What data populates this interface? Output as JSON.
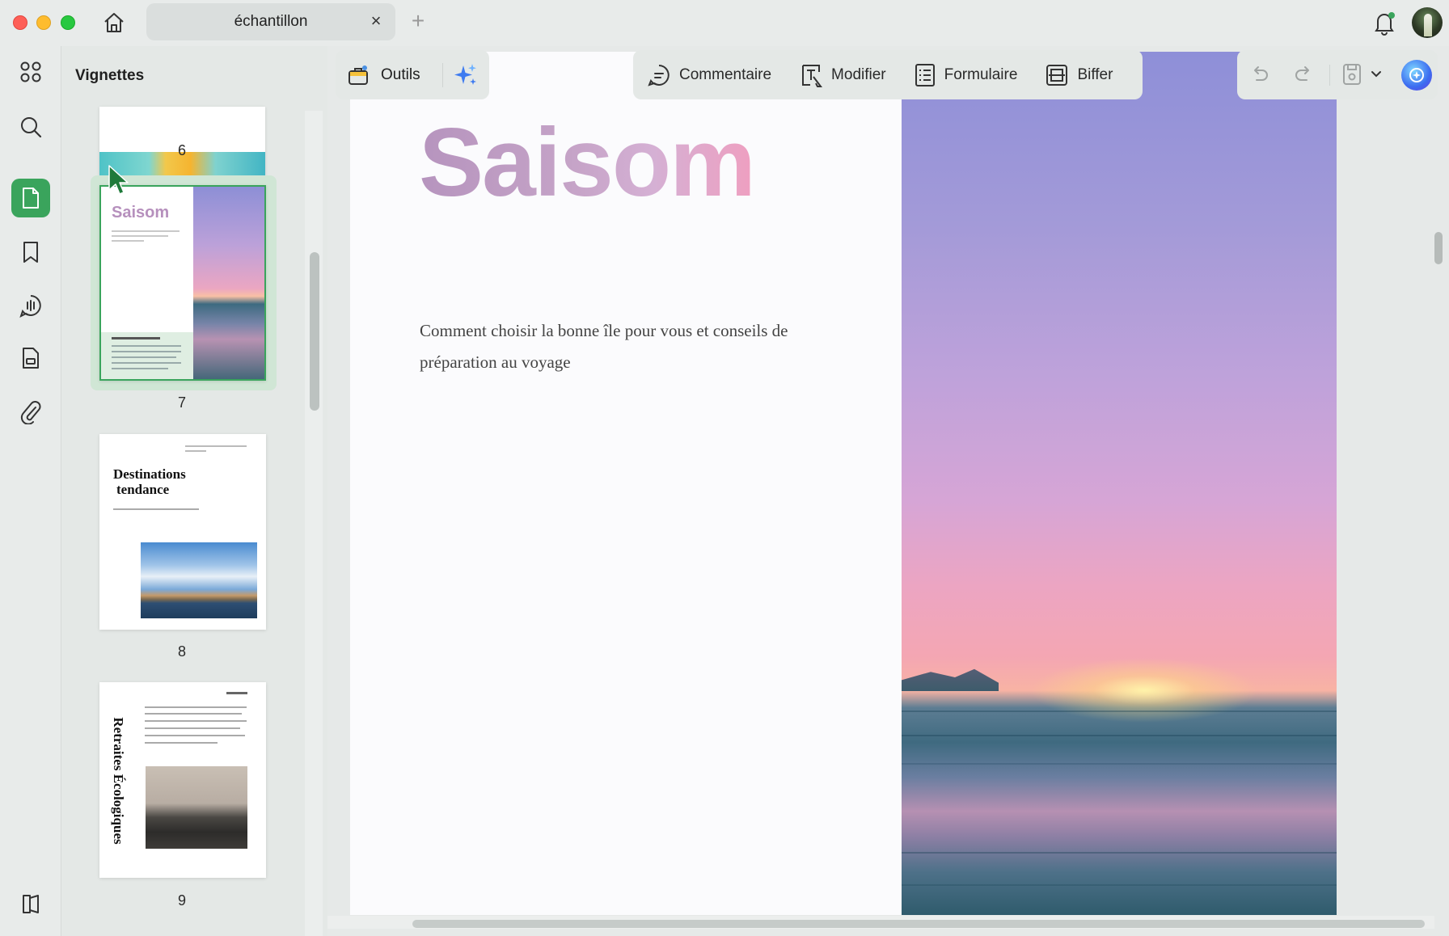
{
  "window": {
    "tab_title": "échantillon",
    "tab_close": "×",
    "new_tab": "+"
  },
  "sidebar": {
    "title": "Vignettes",
    "rail_icons": [
      "grid-icon",
      "search-icon",
      "pages-icon",
      "bookmark-icon",
      "comments-icon",
      "attachment-page-icon",
      "paperclip-icon",
      "panel-toggle-icon"
    ],
    "thumbnails": [
      {
        "page": "6"
      },
      {
        "page": "7",
        "heading": "Saisom"
      },
      {
        "page": "8",
        "heading_line1": "Destinations",
        "heading_line2": "tendance"
      },
      {
        "page": "9",
        "heading": "Retraites Écologiques"
      }
    ]
  },
  "toolbar": {
    "outils": "Outils",
    "commentaire": "Commentaire",
    "modifier": "Modifier",
    "formulaire": "Formulaire",
    "biffer": "Biffer"
  },
  "document": {
    "headline": "Saisom",
    "subtitle": "Comment choisir la bonne île pour vous et conseils de préparation au voyage"
  },
  "colors": {
    "accent_green": "#3aa45c",
    "thumbnail_selected_border": "#3aa45c",
    "headline_purple": "#b694be"
  }
}
